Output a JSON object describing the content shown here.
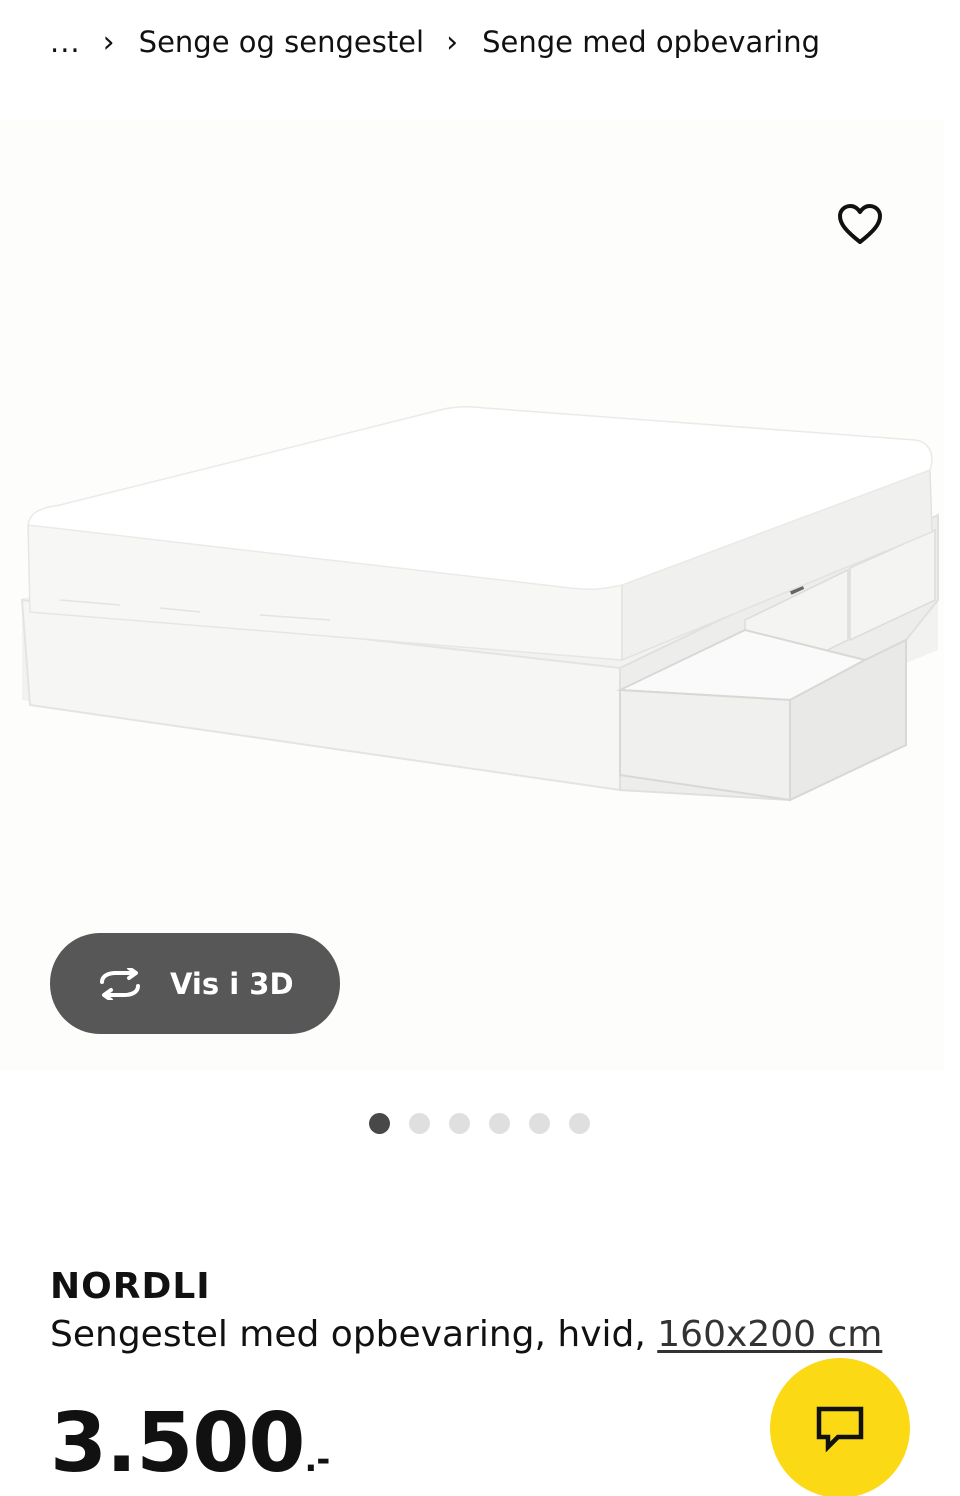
{
  "breadcrumb": {
    "ellipsis": "...",
    "items": [
      {
        "label": "Senge og sengestel"
      },
      {
        "label": "Senge med opbevaring"
      }
    ],
    "separator": "›"
  },
  "gallery": {
    "favorite_icon": "heart-outline-icon",
    "view3d_label": "Vis i 3D",
    "view3d_icon": "rotate-arrows-icon",
    "dots_total": 6,
    "dots_active_index": 0
  },
  "product": {
    "name": "NORDLI",
    "description": "Sengestel med opbevaring, hvid,",
    "size": "160x200 cm",
    "price": "3.500",
    "price_suffix": ".-"
  },
  "chat": {
    "icon": "chat-bubble-icon",
    "color": "#fbd914"
  },
  "colors": {
    "button_dark": "#575757",
    "dot_active": "#484848",
    "dot_inactive": "#dfdfdf"
  }
}
